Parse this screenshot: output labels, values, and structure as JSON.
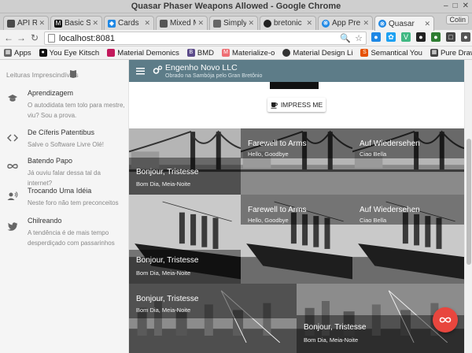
{
  "window": {
    "title": "Quasar Phaser Weapons Allowed - Google Chrome"
  },
  "tabs": [
    {
      "label": "API Refe",
      "favicon_color": "#4a4a4a"
    },
    {
      "label": "Basic Si",
      "favicon_color": "#111111"
    },
    {
      "label": "Cards",
      "favicon_color": "#1e88e5"
    },
    {
      "label": "Mixed M",
      "favicon_color": "#555555"
    },
    {
      "label": "Simply",
      "favicon_color": "#666666"
    },
    {
      "label": "bretonic",
      "favicon_color": "#222222"
    },
    {
      "label": "App Pre",
      "favicon_color": "#1e88e5"
    },
    {
      "label": "Quasar",
      "favicon_color": "#1e88e5"
    }
  ],
  "profile_label": "Colin",
  "address": {
    "url": "localhost:8081"
  },
  "bookmarks": [
    {
      "label": "Apps",
      "color": "#666666"
    },
    {
      "label": "You Eye Kitsch",
      "color": "#111111"
    },
    {
      "label": "Material Demonics",
      "color": "#c2185b"
    },
    {
      "label": "BMD",
      "color": "#5c4b8a"
    },
    {
      "label": "Materialize-o",
      "color": "#ee6e73"
    },
    {
      "label": "Material Design Li",
      "color": "#333333"
    },
    {
      "label": "Semantical You",
      "color": "#e65100"
    },
    {
      "label": "Pure Drawer",
      "color": "#444444"
    }
  ],
  "drawer": {
    "header": "Leituras Imprescindíveis",
    "items": [
      {
        "icon": "school-icon",
        "title": "Aprendizagem",
        "subtitle": "O autodidata tem tolo para mestre, viu? Sou a prova."
      },
      {
        "icon": "code-icon",
        "title": "De Cíferis Patentibus",
        "subtitle": "Salve o Software Livre Olé!"
      },
      {
        "icon": "infinity-icon",
        "title": "Batendo Papo",
        "subtitle": "Já ouviu falar dessa tal da internet?"
      },
      {
        "icon": "record-voice-icon",
        "title": "Trocando Uma Idéia",
        "subtitle": "Neste foro não tem preconceitos"
      },
      {
        "icon": "twitter-icon",
        "title": "Chilreando",
        "subtitle": "A tendência é de mais tempo desperdiçado com passarinhos"
      }
    ]
  },
  "toolbar": {
    "title": "Engenho Novo LLC",
    "subtitle": "Obrado na Sambója pelo Gran Bretônio"
  },
  "impress_button": {
    "label": "IMPRESS ME"
  },
  "cards": [
    {
      "title": "Bonjour, Tristesse",
      "subtitle": "Bom Dia, Meia-Noite",
      "scene": "bridge"
    },
    {
      "title": "Farewell to Arms",
      "subtitle": "Hello, Goodbye",
      "scene": "bridge"
    },
    {
      "title": "Auf Wiedersehen",
      "subtitle": "Ciao Bella",
      "scene": "bridge"
    },
    {
      "title": "Bonjour, Tristesse",
      "subtitle": "Bom Dia, Meia-Noite",
      "scene": "ship"
    },
    {
      "title": "Farewell to Arms",
      "subtitle": "Hello, Goodbye",
      "scene": "ship"
    },
    {
      "title": "Auf Wiedersehen",
      "subtitle": "Ciao Bella",
      "scene": "ship"
    },
    {
      "title": "Bonjour, Tristesse",
      "subtitle": "Bom Dia, Meia-Noite",
      "scene": "city"
    },
    {
      "title": "Bonjour, Tristesse",
      "subtitle": "Bom Dia, Meia-Noite",
      "scene": "city"
    }
  ],
  "colors": {
    "toolbar": "#5d7c88",
    "fab": "#e8463e",
    "drawer_bg": "#f5f5f5"
  },
  "fab": {
    "icon": "infinity-icon"
  }
}
